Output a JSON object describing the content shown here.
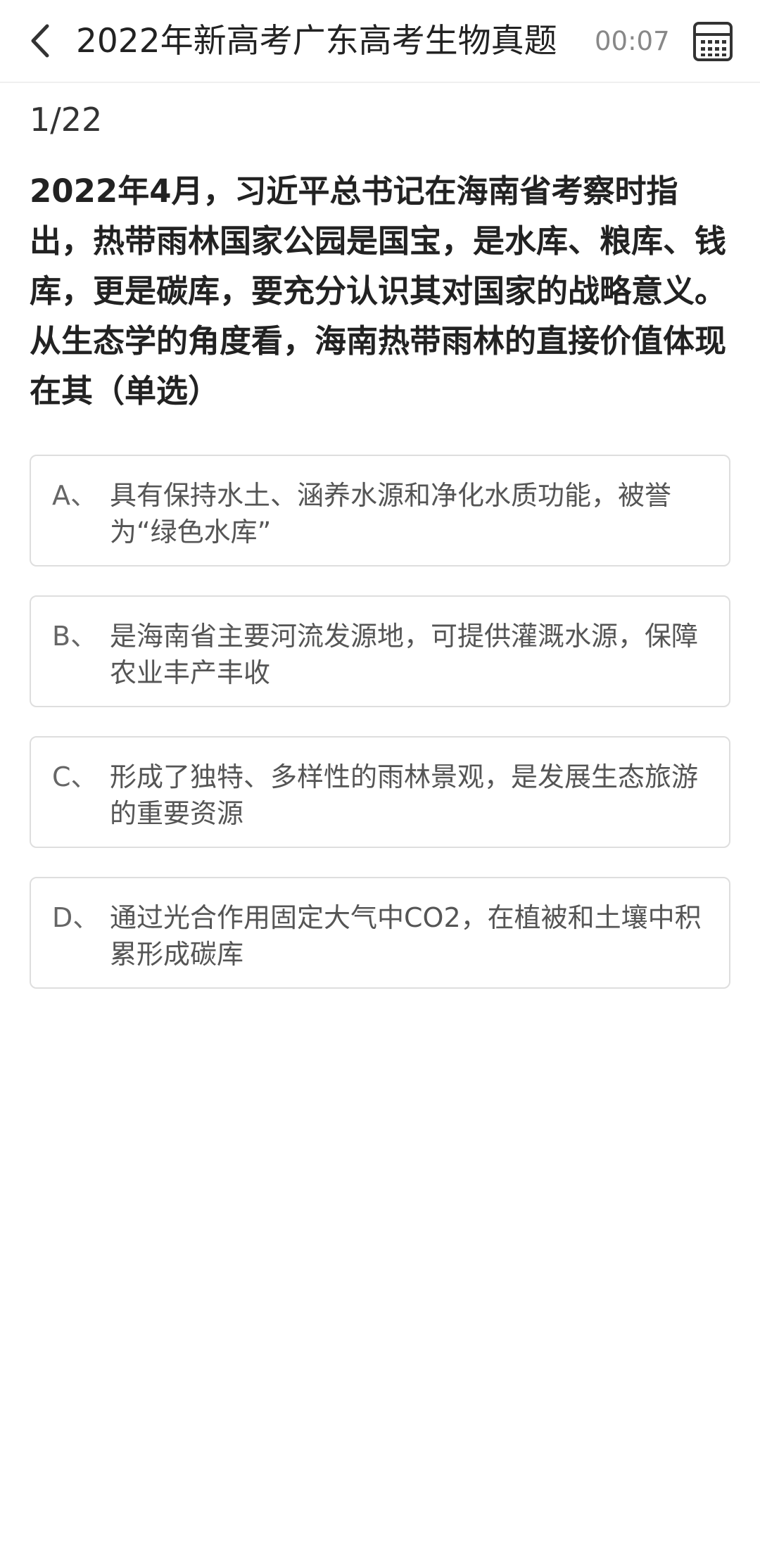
{
  "header": {
    "title": "2022年新高考广东高考生物真题",
    "timer": "00:07",
    "back_icon": "chevron-left-icon",
    "sheet_icon": "answer-sheet-grid-icon"
  },
  "progress": "1/22",
  "question": {
    "text": "2022年4月，习近平总书记在海南省考察时指出，热带雨林国家公园是国宝，是水库、粮库、钱库，更是碳库，要充分认识其对国家的战略意义。从生态学的角度看，海南热带雨林的直接价值体现在其（单选）"
  },
  "options": [
    {
      "letter": "A、",
      "text": "具有保持水土、涵养水源和净化水质功能，被誉为“绿色水库”"
    },
    {
      "letter": "B、",
      "text": "是海南省主要河流发源地，可提供灌溉水源，保障农业丰产丰收"
    },
    {
      "letter": "C、",
      "text": "形成了独特、多样性的雨林景观，是发展生态旅游的重要资源"
    },
    {
      "letter": "D、",
      "text": "通过光合作用固定大气中CO2，在植被和土壤中积累形成碳库"
    }
  ],
  "colors": {
    "text_primary": "#222222",
    "text_secondary": "#555555",
    "timer": "#888888",
    "option_border": "#dedede"
  }
}
